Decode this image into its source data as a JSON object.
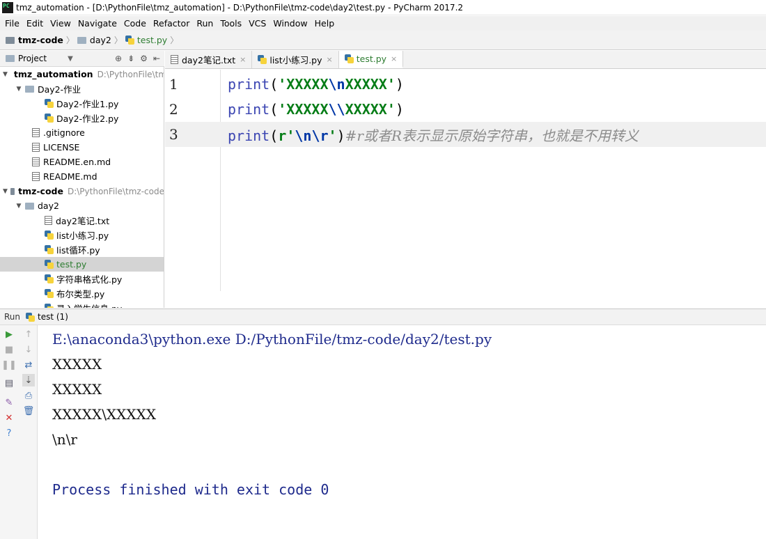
{
  "window": {
    "title": "tmz_automation - [D:\\PythonFile\\tmz_automation] - D:\\PythonFile\\tmz-code\\day2\\test.py - PyCharm 2017.2",
    "app_icon_label": "PC"
  },
  "menu": [
    "File",
    "Edit",
    "View",
    "Navigate",
    "Code",
    "Refactor",
    "Run",
    "Tools",
    "VCS",
    "Window",
    "Help"
  ],
  "breadcrumb": {
    "project": "tmz-code",
    "folder": "day2",
    "file": "test.py"
  },
  "project_panel": {
    "title": "Project",
    "tree": [
      {
        "label": "tmz_automation",
        "path": "D:\\PythonFile\\tmz_automation",
        "type": "project"
      },
      {
        "label": "Day2-作业",
        "type": "folder"
      },
      {
        "label": "Day2-作业1.py",
        "type": "py"
      },
      {
        "label": "Day2-作业2.py",
        "type": "py"
      },
      {
        "label": ".gitignore",
        "type": "txt"
      },
      {
        "label": "LICENSE",
        "type": "txt"
      },
      {
        "label": "README.en.md",
        "type": "txt"
      },
      {
        "label": "README.md",
        "type": "txt"
      },
      {
        "label": "tmz-code",
        "path": "D:\\PythonFile\\tmz-code",
        "type": "project"
      },
      {
        "label": "day2",
        "type": "folder"
      },
      {
        "label": "day2笔记.txt",
        "type": "txt"
      },
      {
        "label": "list小练习.py",
        "type": "py"
      },
      {
        "label": "list循环.py",
        "type": "py"
      },
      {
        "label": "test.py",
        "type": "py"
      },
      {
        "label": "字符串格式化.py",
        "type": "py"
      },
      {
        "label": "布尔类型.py",
        "type": "py"
      },
      {
        "label": "录入学生信息.py",
        "type": "py"
      }
    ]
  },
  "tabs": [
    {
      "label": "day2笔记.txt",
      "close": "×"
    },
    {
      "label": "list小练习.py",
      "close": "×"
    },
    {
      "label": "test.py",
      "close": "×"
    }
  ],
  "editor": {
    "lines": [
      {
        "num": "1",
        "fn": "print",
        "open": "(",
        "prefix": "",
        "s1": "'XXXXX",
        "esc": "\\n",
        "s2": "XXXXX'",
        "close": ")",
        "comment": ""
      },
      {
        "num": "2",
        "fn": "print",
        "open": "(",
        "prefix": "",
        "s1": "'XXXXX",
        "esc": "\\\\",
        "s2": "XXXXX'",
        "close": ")",
        "comment": ""
      },
      {
        "num": "3",
        "fn": "print",
        "open": "(",
        "prefix": "r",
        "s1": "'",
        "esc": "\\n\\r",
        "s2": "'",
        "close": ")",
        "comment": "#r或者R表示显示原始字符串，也就是不用转义"
      }
    ]
  },
  "run_panel": {
    "label": "Run",
    "config": "test (1)",
    "output": [
      "E:\\anaconda3\\python.exe D:/PythonFile/tmz-code/day2/test.py",
      "XXXXX",
      "XXXXX",
      "XXXXX\\XXXXX",
      "\\n\\r",
      "",
      "Process finished with exit code 0"
    ]
  }
}
